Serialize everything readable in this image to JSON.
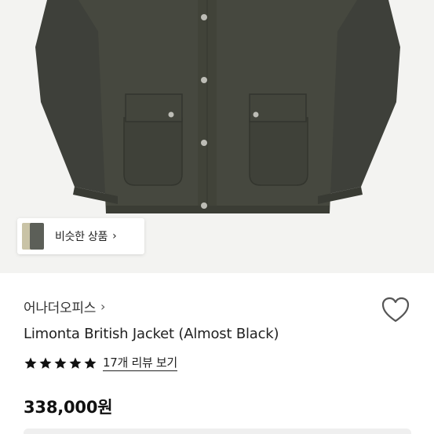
{
  "similar": {
    "label": "비슷한 상품",
    "chevron": "›"
  },
  "brand": {
    "name": "어나더오피스",
    "chevron": "›"
  },
  "product": {
    "title": "Limonta British Jacket (Almost Black)"
  },
  "rating": {
    "stars": 5,
    "review_link": "17개 리뷰 보기"
  },
  "price": "338,000원",
  "colors": {
    "jacket": "#44463f",
    "background": "#f3f3f1",
    "star": "#111111"
  },
  "icons": {
    "wishlist": "heart-outline-icon",
    "rating": "star-icon"
  }
}
